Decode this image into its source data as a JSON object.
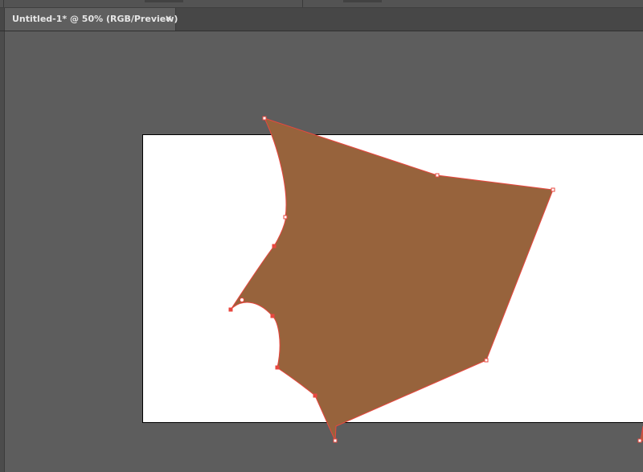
{
  "document": {
    "tab_title": "Untitled-1* @ 50% (RGB/Preview)",
    "close_glyph": "×"
  },
  "icons": {
    "close": "close-icon"
  },
  "colors": {
    "shape_fill": "#97633C",
    "path_stroke": "#E8473F",
    "artboard": "#FFFFFF",
    "pasteboard": "#5D5D5D"
  }
}
